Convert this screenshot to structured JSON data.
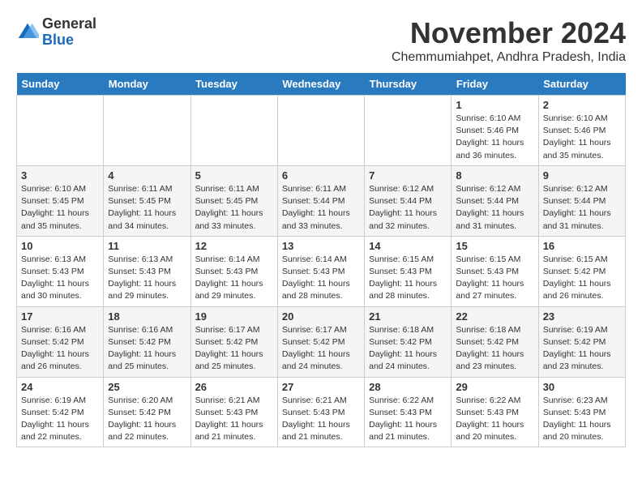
{
  "logo": {
    "general": "General",
    "blue": "Blue"
  },
  "title": "November 2024",
  "location": "Chemmumiahpet, Andhra Pradesh, India",
  "headers": [
    "Sunday",
    "Monday",
    "Tuesday",
    "Wednesday",
    "Thursday",
    "Friday",
    "Saturday"
  ],
  "weeks": [
    [
      {
        "day": "",
        "info": ""
      },
      {
        "day": "",
        "info": ""
      },
      {
        "day": "",
        "info": ""
      },
      {
        "day": "",
        "info": ""
      },
      {
        "day": "",
        "info": ""
      },
      {
        "day": "1",
        "info": "Sunrise: 6:10 AM\nSunset: 5:46 PM\nDaylight: 11 hours and 36 minutes."
      },
      {
        "day": "2",
        "info": "Sunrise: 6:10 AM\nSunset: 5:46 PM\nDaylight: 11 hours and 35 minutes."
      }
    ],
    [
      {
        "day": "3",
        "info": "Sunrise: 6:10 AM\nSunset: 5:45 PM\nDaylight: 11 hours and 35 minutes."
      },
      {
        "day": "4",
        "info": "Sunrise: 6:11 AM\nSunset: 5:45 PM\nDaylight: 11 hours and 34 minutes."
      },
      {
        "day": "5",
        "info": "Sunrise: 6:11 AM\nSunset: 5:45 PM\nDaylight: 11 hours and 33 minutes."
      },
      {
        "day": "6",
        "info": "Sunrise: 6:11 AM\nSunset: 5:44 PM\nDaylight: 11 hours and 33 minutes."
      },
      {
        "day": "7",
        "info": "Sunrise: 6:12 AM\nSunset: 5:44 PM\nDaylight: 11 hours and 32 minutes."
      },
      {
        "day": "8",
        "info": "Sunrise: 6:12 AM\nSunset: 5:44 PM\nDaylight: 11 hours and 31 minutes."
      },
      {
        "day": "9",
        "info": "Sunrise: 6:12 AM\nSunset: 5:44 PM\nDaylight: 11 hours and 31 minutes."
      }
    ],
    [
      {
        "day": "10",
        "info": "Sunrise: 6:13 AM\nSunset: 5:43 PM\nDaylight: 11 hours and 30 minutes."
      },
      {
        "day": "11",
        "info": "Sunrise: 6:13 AM\nSunset: 5:43 PM\nDaylight: 11 hours and 29 minutes."
      },
      {
        "day": "12",
        "info": "Sunrise: 6:14 AM\nSunset: 5:43 PM\nDaylight: 11 hours and 29 minutes."
      },
      {
        "day": "13",
        "info": "Sunrise: 6:14 AM\nSunset: 5:43 PM\nDaylight: 11 hours and 28 minutes."
      },
      {
        "day": "14",
        "info": "Sunrise: 6:15 AM\nSunset: 5:43 PM\nDaylight: 11 hours and 28 minutes."
      },
      {
        "day": "15",
        "info": "Sunrise: 6:15 AM\nSunset: 5:43 PM\nDaylight: 11 hours and 27 minutes."
      },
      {
        "day": "16",
        "info": "Sunrise: 6:15 AM\nSunset: 5:42 PM\nDaylight: 11 hours and 26 minutes."
      }
    ],
    [
      {
        "day": "17",
        "info": "Sunrise: 6:16 AM\nSunset: 5:42 PM\nDaylight: 11 hours and 26 minutes."
      },
      {
        "day": "18",
        "info": "Sunrise: 6:16 AM\nSunset: 5:42 PM\nDaylight: 11 hours and 25 minutes."
      },
      {
        "day": "19",
        "info": "Sunrise: 6:17 AM\nSunset: 5:42 PM\nDaylight: 11 hours and 25 minutes."
      },
      {
        "day": "20",
        "info": "Sunrise: 6:17 AM\nSunset: 5:42 PM\nDaylight: 11 hours and 24 minutes."
      },
      {
        "day": "21",
        "info": "Sunrise: 6:18 AM\nSunset: 5:42 PM\nDaylight: 11 hours and 24 minutes."
      },
      {
        "day": "22",
        "info": "Sunrise: 6:18 AM\nSunset: 5:42 PM\nDaylight: 11 hours and 23 minutes."
      },
      {
        "day": "23",
        "info": "Sunrise: 6:19 AM\nSunset: 5:42 PM\nDaylight: 11 hours and 23 minutes."
      }
    ],
    [
      {
        "day": "24",
        "info": "Sunrise: 6:19 AM\nSunset: 5:42 PM\nDaylight: 11 hours and 22 minutes."
      },
      {
        "day": "25",
        "info": "Sunrise: 6:20 AM\nSunset: 5:42 PM\nDaylight: 11 hours and 22 minutes."
      },
      {
        "day": "26",
        "info": "Sunrise: 6:21 AM\nSunset: 5:43 PM\nDaylight: 11 hours and 21 minutes."
      },
      {
        "day": "27",
        "info": "Sunrise: 6:21 AM\nSunset: 5:43 PM\nDaylight: 11 hours and 21 minutes."
      },
      {
        "day": "28",
        "info": "Sunrise: 6:22 AM\nSunset: 5:43 PM\nDaylight: 11 hours and 21 minutes."
      },
      {
        "day": "29",
        "info": "Sunrise: 6:22 AM\nSunset: 5:43 PM\nDaylight: 11 hours and 20 minutes."
      },
      {
        "day": "30",
        "info": "Sunrise: 6:23 AM\nSunset: 5:43 PM\nDaylight: 11 hours and 20 minutes."
      }
    ]
  ]
}
